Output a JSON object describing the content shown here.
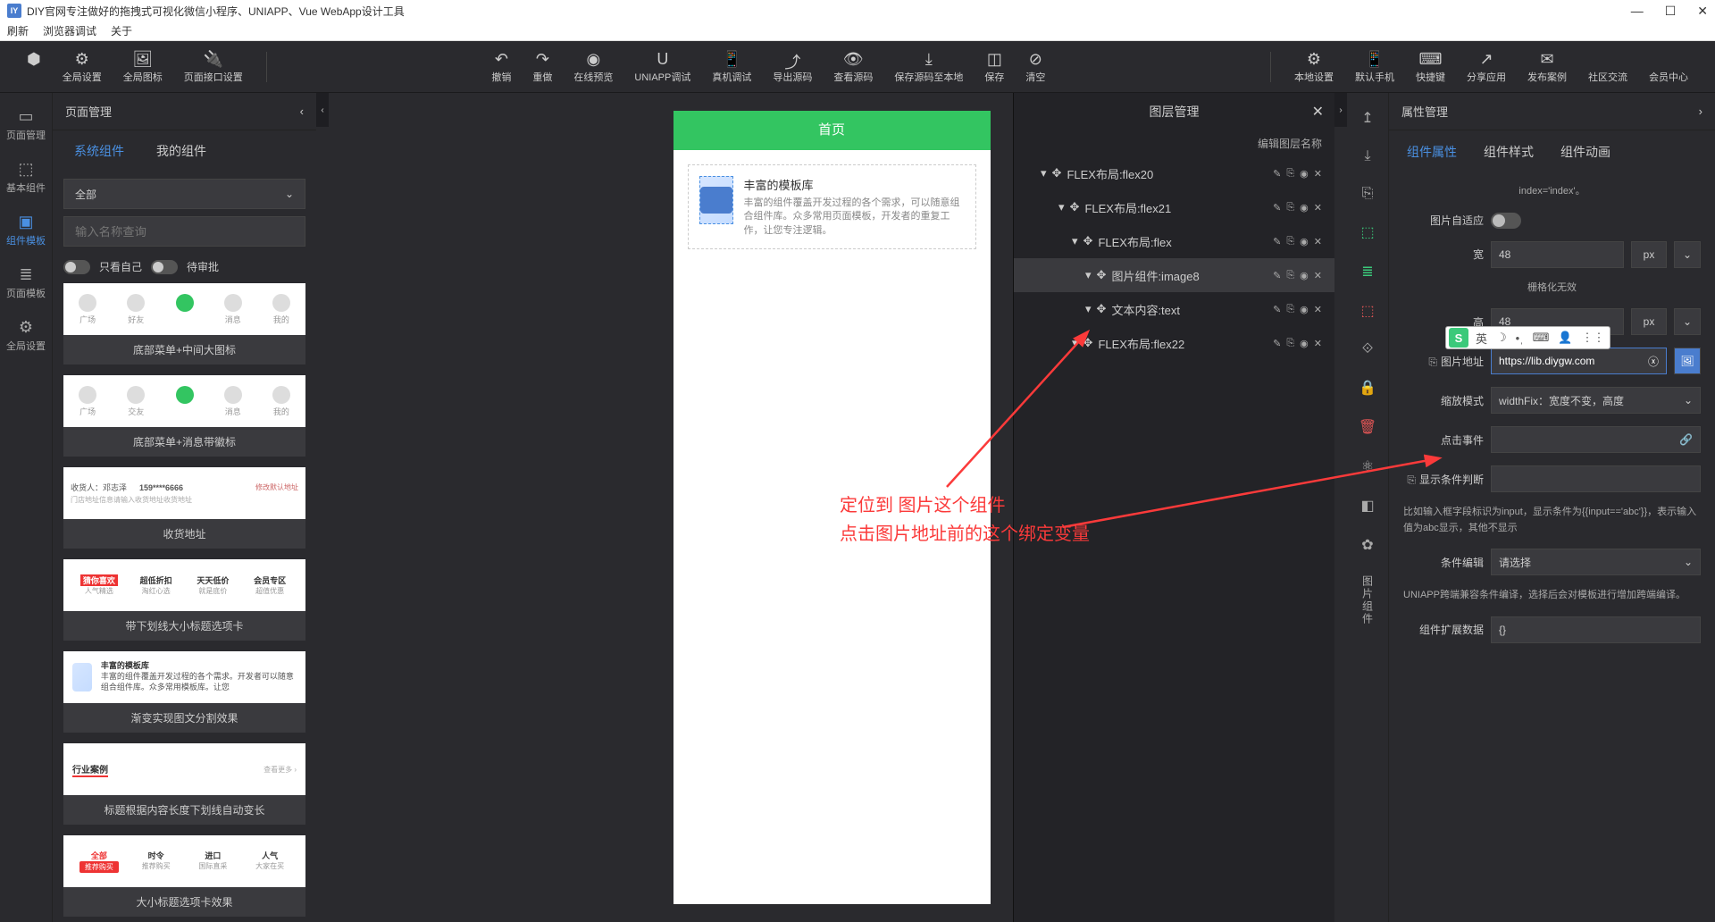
{
  "window": {
    "title": "DIY官网专注做好的拖拽式可视化微信小程序、UNIAPP、Vue WebApp设计工具",
    "menu": [
      "刷新",
      "浏览器调试",
      "关于"
    ],
    "winbtns": [
      "—",
      "☐",
      "✕"
    ]
  },
  "toolbar": {
    "left": [
      {
        "icon": "⬢",
        "label": ""
      },
      {
        "icon": "⚙",
        "label": "全局设置"
      },
      {
        "icon": "🖼",
        "label": "全局图标"
      },
      {
        "icon": "🔌",
        "label": "页面接口设置"
      }
    ],
    "mid": [
      {
        "icon": "↶",
        "label": "撤销"
      },
      {
        "icon": "↷",
        "label": "重做"
      },
      {
        "icon": "◉",
        "label": "在线预览"
      },
      {
        "icon": "U",
        "label": "UNIAPP调试"
      },
      {
        "icon": "📱",
        "label": "真机调试"
      },
      {
        "icon": "⤴",
        "label": "导出源码"
      },
      {
        "icon": "👁",
        "label": "查看源码"
      },
      {
        "icon": "⤓",
        "label": "保存源码至本地"
      },
      {
        "icon": "◫",
        "label": "保存"
      },
      {
        "icon": "⊘",
        "label": "清空"
      }
    ],
    "right": [
      {
        "icon": "⚙",
        "label": "本地设置"
      },
      {
        "icon": "📱",
        "label": "默认手机"
      },
      {
        "icon": "⌨",
        "label": "快捷键"
      },
      {
        "icon": "↗",
        "label": "分享应用"
      },
      {
        "icon": "✉",
        "label": "发布案例"
      },
      {
        "icon": "",
        "label": "社区交流"
      },
      {
        "icon": "",
        "label": "会员中心"
      }
    ]
  },
  "leftNav": [
    {
      "icon": "▭",
      "label": "页面管理"
    },
    {
      "icon": "⬚",
      "label": "基本组件"
    },
    {
      "icon": "▣",
      "label": "组件模板",
      "active": true
    },
    {
      "icon": "≣",
      "label": "页面模板"
    },
    {
      "icon": "⚙",
      "label": "全局设置"
    }
  ],
  "leftPanel": {
    "title": "页面管理",
    "tabs": [
      "系统组件",
      "我的组件"
    ],
    "filter": "全部",
    "searchPlaceholder": "输入名称查询",
    "toggle1": "只看自己",
    "toggle2": "待审批",
    "templates": [
      {
        "label": "底部菜单+中间大图标",
        "preview": "tabbar",
        "items": [
          "广场",
          "好友",
          "",
          "消息",
          "我的"
        ]
      },
      {
        "label": "底部菜单+消息带徽标",
        "preview": "tabbar",
        "items": [
          "广场",
          "交友",
          "",
          "消息",
          "我的"
        ]
      },
      {
        "label": "收货地址",
        "preview": "addr",
        "name": "收货人：邓志泽",
        "phone": "159****6666",
        "tag": "修改默认地址"
      },
      {
        "label": "带下划线大小标题选项卡",
        "preview": "tabs",
        "cols": [
          [
            "猜你喜欢",
            "人气精选"
          ],
          [
            "超低折扣",
            "淘红心选"
          ],
          [
            "天天低价",
            "就是底价"
          ],
          [
            "会员专区",
            "超值优惠"
          ]
        ]
      },
      {
        "label": "渐变实现图文分割效果",
        "preview": "lib",
        "title": "丰富的模板库",
        "desc": "丰富的组件覆盖开发过程的各个需求。开发者可以随意组合组件库。众多常用模板库。让您专注开发。"
      },
      {
        "label": "标题根据内容长度下划线自动变长",
        "preview": "case",
        "title": "行业案例"
      },
      {
        "label": "大小标题选项卡效果",
        "preview": "tabs2",
        "cols": [
          [
            "全部",
            "推荐购买"
          ],
          [
            "时令",
            "推荐购买"
          ],
          [
            "进口",
            "国际直采"
          ],
          [
            "人气",
            "大家在买"
          ]
        ]
      }
    ]
  },
  "phone": {
    "title": "首页",
    "card": {
      "title": "丰富的模板库",
      "desc": "丰富的组件覆盖开发过程的各个需求，可以随意组合组件库。众多常用页面模板，开发者的重复工作，让您专注逻辑。"
    }
  },
  "layers": {
    "title": "图层管理",
    "sub": "编辑图层名称",
    "tree": [
      {
        "label": "FLEX布局:flex20",
        "depth": 1
      },
      {
        "label": "FLEX布局:flex21",
        "depth": 2
      },
      {
        "label": "FLEX布局:flex",
        "depth": 3
      },
      {
        "label": "图片组件:image8",
        "depth": 4,
        "selected": true
      },
      {
        "label": "文本内容:text",
        "depth": 4
      },
      {
        "label": "FLEX布局:flex22",
        "depth": 3
      }
    ],
    "actions": [
      "✎",
      "⎘",
      "◉",
      "✕"
    ]
  },
  "rightNav": {
    "icons": [
      "↥",
      "⤓",
      "⎘",
      "⬚g",
      "≣g",
      "⬚r",
      "⟐",
      "🔒",
      "🗑r",
      "⚛",
      "◧",
      "✿"
    ],
    "label": "图片组件"
  },
  "props": {
    "title": "属性管理",
    "tabs": [
      "组件属性",
      "组件样式",
      "组件动画"
    ],
    "indexText": "index='index'。",
    "rows": {
      "adaptive": "图片自适应",
      "width": {
        "label": "宽",
        "value": "48",
        "unit": "px"
      },
      "gridNote": "栅格化无效",
      "height": {
        "label": "高",
        "value": "48",
        "unit": "px"
      },
      "url": {
        "label": "图片地址",
        "value": "https://lib.diygw.com"
      },
      "scale": {
        "label": "缩放模式",
        "value": "widthFix：宽度不变，高度"
      },
      "click": {
        "label": "点击事件",
        "value": ""
      },
      "cond": {
        "label": "显示条件判断",
        "value": ""
      },
      "condNote": "比如输入框字段标识为input，显示条件为{{input=='abc'}}，表示输入值为abc显示，其他不显示",
      "condEdit": {
        "label": "条件编辑",
        "value": "请选择"
      },
      "condEditNote": "UNIAPP跨端兼容条件编译，选择后会对模板进行增加跨端编译。",
      "ext": {
        "label": "组件扩展数据",
        "value": "{}"
      }
    }
  },
  "annotation": {
    "line1": "定位到 图片这个组件",
    "line2": "点击图片地址前的这个绑定变量"
  },
  "ime": {
    "s": "S",
    "t1": "英",
    "t2": "☽",
    "t3": "•ˌ",
    "t4": "⌨",
    "t5": "👤",
    "t6": "⋮⋮"
  }
}
